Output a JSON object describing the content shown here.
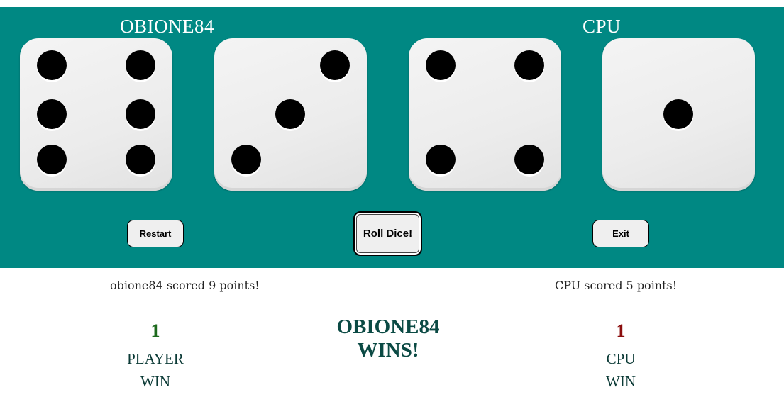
{
  "players": {
    "left_name": "OBIONE84",
    "right_name": "CPU"
  },
  "dice": [
    {
      "value": 6
    },
    {
      "value": 3
    },
    {
      "value": 4
    },
    {
      "value": 1
    }
  ],
  "buttons": {
    "restart_label": "Restart",
    "roll_label": "Roll Dice!",
    "exit_label": "Exit"
  },
  "messages": {
    "player_score": "obione84 scored 9 points!",
    "cpu_score": "CPU scored 5 points!"
  },
  "tally": {
    "player": {
      "count": "1",
      "label_top": "PLAYER",
      "label_bottom": "WIN"
    },
    "cpu": {
      "count": "1",
      "label_top": "CPU",
      "label_bottom": "WIN"
    }
  },
  "result": {
    "line1": "OBIONE84",
    "line2": "WINS!"
  },
  "colors": {
    "board": "#008883",
    "player_count": "#1d6a1d",
    "cpu_count": "#8b0e0e"
  }
}
